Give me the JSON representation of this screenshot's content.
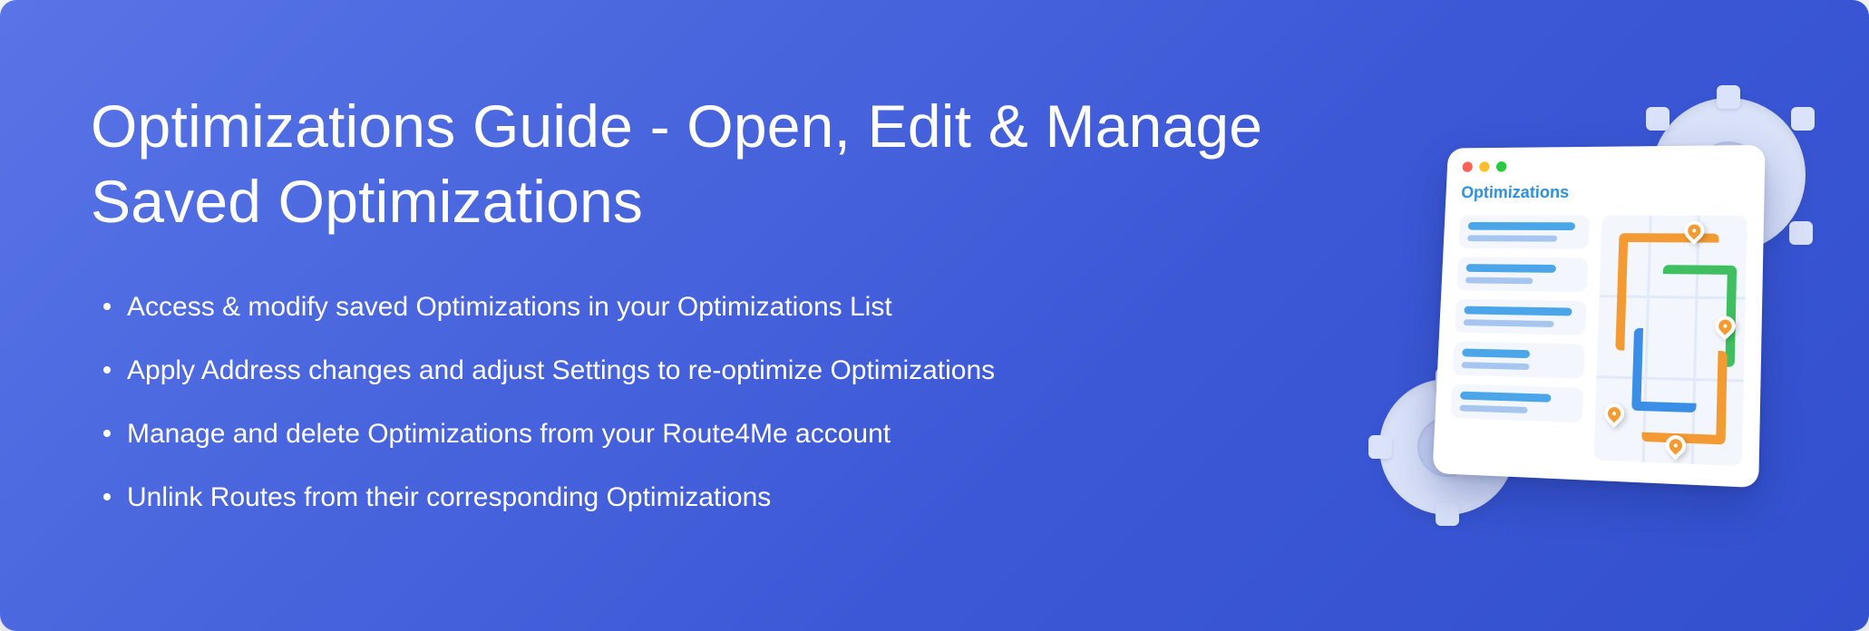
{
  "title": "Optimizations Guide - Open, Edit & Manage Saved Optimizations",
  "bullets": [
    "Access & modify saved Optimizations in your Optimizations List",
    "Apply Address changes and adjust Settings to re-optimize Optimizations",
    "Manage and delete Optimizations from your Route4Me account",
    "Unlink Routes from their corresponding Optimizations"
  ],
  "illustration": {
    "card_title": "Optimizations"
  }
}
